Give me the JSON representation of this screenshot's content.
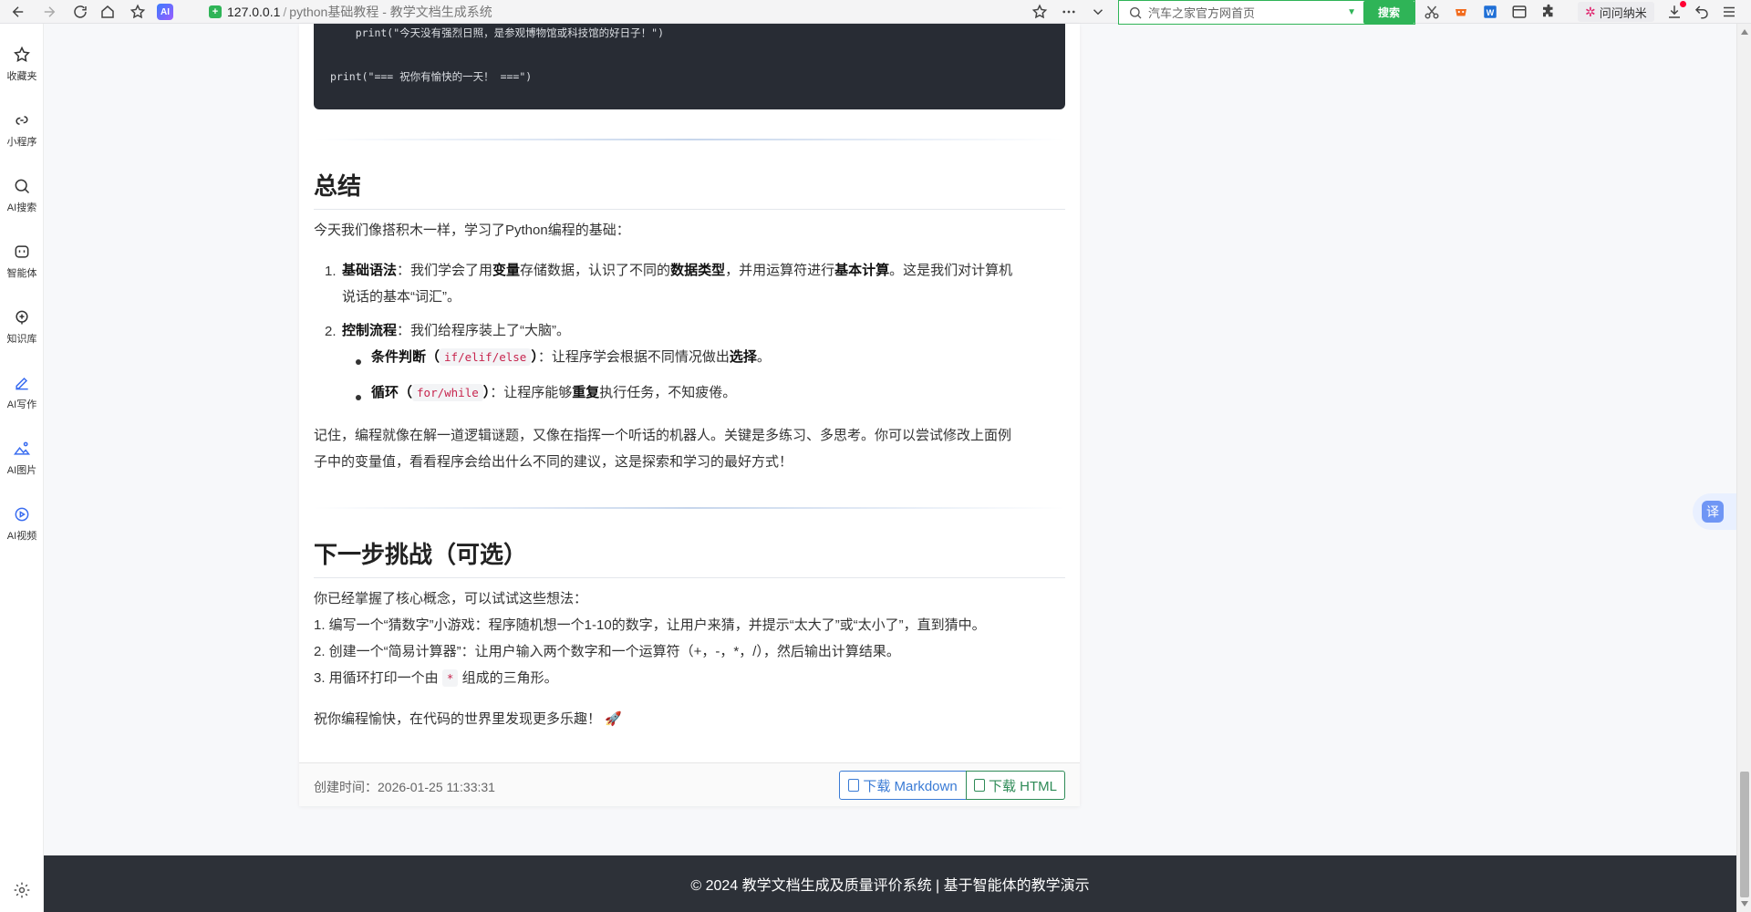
{
  "browser": {
    "address_host": "127.0.0.1",
    "address_sep": "/",
    "tab_title": "python基础教程 - 教学文档生成系统",
    "ai_badge": "AI",
    "search_placeholder": "汽车之家官方网首页",
    "search_button": "搜索",
    "wenwen_label": "问问纳米"
  },
  "sidebar": {
    "items": [
      {
        "label": "收藏夹",
        "icon": "star-icon"
      },
      {
        "label": "小程序",
        "icon": "link-icon"
      },
      {
        "label": "AI搜索",
        "icon": "search-icon"
      },
      {
        "label": "智能体",
        "icon": "agent-icon"
      },
      {
        "label": "知识库",
        "icon": "knowledge-icon"
      },
      {
        "label": "AI写作",
        "icon": "write-icon"
      },
      {
        "label": "AI图片",
        "icon": "image-icon"
      },
      {
        "label": "AI视频",
        "icon": "video-icon"
      }
    ]
  },
  "code": {
    "line1": "    print(\"今天没有强烈日照，是参观博物馆或科技馆的好日子！\")",
    "line2": "print(\"=== 祝你有愉快的一天！ ===\")"
  },
  "summary": {
    "heading": "总结",
    "intro": "今天我们像搭积木一样，学习了Python编程的基础：",
    "item1_num": "1.",
    "item1_title": "基础语法",
    "item1_a": "：我们学会了用",
    "item1_b": "变量",
    "item1_c": "存储数据，认识了不同的",
    "item1_d": "数据类型",
    "item1_e": "，并用运算符进行",
    "item1_f": "基本计算",
    "item1_g": "。这是我们对计算机",
    "item1_h": "说话的基本“词汇”。",
    "item2_num": "2.",
    "item2_title": "控制流程",
    "item2_text": "：我们给程序装上了“大脑”。",
    "sub1_title": "条件判断（",
    "sub1_code": "if/elif/else",
    "sub1_close": "）",
    "sub1_text": "：让程序学会根据不同情况做出",
    "sub1_bold": "选择",
    "sub1_end": "。",
    "sub2_title": "循环（",
    "sub2_code": "for/while",
    "sub2_close": "）",
    "sub2_text": "：让程序能够",
    "sub2_bold": "重复",
    "sub2_end": "执行任务，不知疲倦。",
    "remember_1": "记住，编程就像在解一道逻辑谜题，又像在指挥一个听话的机器人。关键是多练习、多思考。你可以尝试修改上面例",
    "remember_2": "子中的变量值，看看程序会给出什么不同的建议，这是探索和学习的最好方式！"
  },
  "challenge": {
    "heading": "下一步挑战（可选）",
    "intro": "你已经掌握了核心概念，可以试试这些想法：",
    "line1": "1. 编写一个“猜数字”小游戏：程序随机想一个1-10的数字，让用户来猜，并提示“太大了”或“太小了”，直到猜中。",
    "line2": "2. 创建一个“简易计算器”：让用户输入两个数字和一个运算符（+，-，*，/），然后输出计算结果。",
    "line3_a": "3. 用循环打印一个由",
    "line3_code": "*",
    "line3_b": "组成的三角形。",
    "closing": "祝你编程愉快，在代码的世界里发现更多乐趣！",
    "closing_emoji": "🚀"
  },
  "card_footer": {
    "created": "创建时间：2026-01-25 11:33:31",
    "download_md": "下载 Markdown",
    "download_html": "下载 HTML"
  },
  "translate_label": "译",
  "site_footer": "© 2024 教学文档生成及质量评价系统 | 基于智能体的教学演示"
}
